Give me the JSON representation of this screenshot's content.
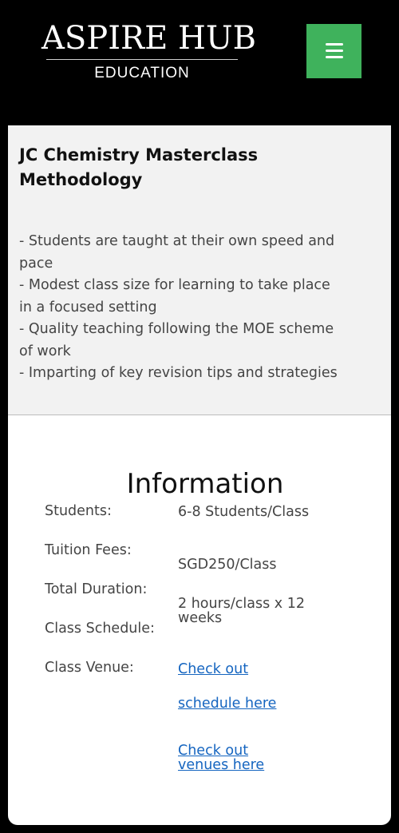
{
  "header": {
    "logo_main": "ASPIRE HUB",
    "logo_sub": "EDUCATION",
    "menu_icon": "hamburger-menu-icon",
    "menu_color": "#3fb25c"
  },
  "methodology": {
    "title": "JC Chemistry Masterclass Methodology",
    "points": [
      "- Students are taught at their own speed and pace",
      "- Modest class size for learning  to take place in a focused setting",
      "- Quality teaching following the MOE scheme of work",
      "- Imparting of key revision tips and strategies"
    ]
  },
  "information": {
    "title": "Information",
    "labels": {
      "students": "Students:",
      "fees": "Tuition Fees:",
      "duration": "Total Duration:",
      "schedule": "Class Schedule:",
      "venue": "Class Venue:"
    },
    "values": {
      "students": "6-8 Students/Class",
      "fees": "SGD250/Class",
      "duration": "2 hours/class x 12 weeks"
    },
    "links": {
      "schedule_line1": "Check out",
      "schedule_line2": "schedule here",
      "venues": "Check out venues here"
    },
    "link_color": "#1565c0"
  }
}
